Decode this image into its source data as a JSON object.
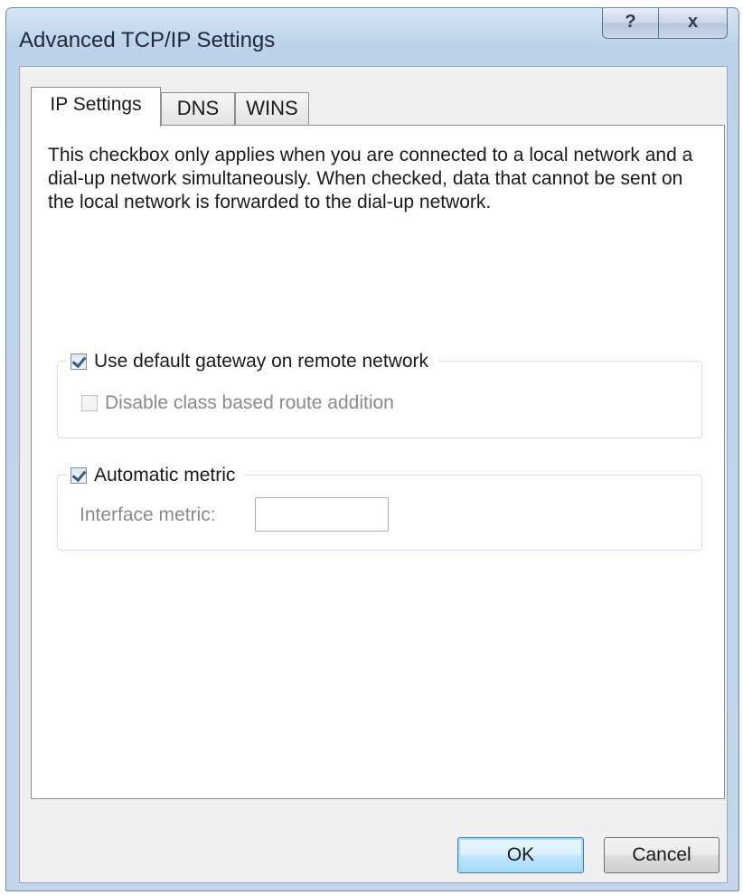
{
  "window": {
    "title": "Advanced TCP/IP Settings",
    "help_glyph": "?",
    "close_glyph": "x"
  },
  "tabs": [
    {
      "label": "IP Settings",
      "active": true
    },
    {
      "label": "DNS",
      "active": false
    },
    {
      "label": "WINS",
      "active": false
    }
  ],
  "panel": {
    "description": "This checkbox only applies when you are connected to a local network and a dial-up network simultaneously.  When checked, data that cannot be sent on the local network is forwarded to the dial-up network.",
    "gateway_group": {
      "label": "Use default gateway on remote network",
      "checked": true,
      "disable_class_route_label": "Disable class based route addition",
      "disable_class_route_checked": false
    },
    "metric_group": {
      "label": "Automatic metric",
      "checked": true,
      "interface_metric_label": "Interface metric:",
      "interface_metric_value": ""
    }
  },
  "buttons": {
    "ok_label": "OK",
    "cancel_label": "Cancel"
  },
  "icons": {
    "help": "help-icon",
    "close": "close-icon",
    "checkbox": "checkbox-icon"
  }
}
